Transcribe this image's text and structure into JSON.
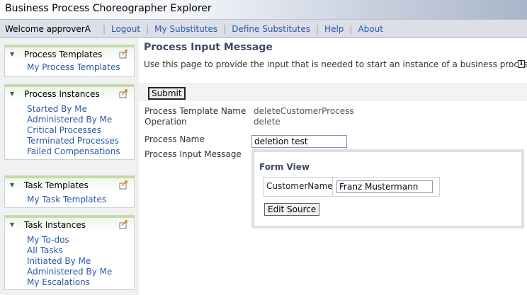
{
  "app": {
    "title": "Business Process Choreographer Explorer"
  },
  "nav": {
    "welcome": "Welcome approverA",
    "links": [
      "Logout",
      "My Substitutes",
      "Define Substitutes",
      "Help",
      "About"
    ],
    "separator": "|"
  },
  "sidebar": {
    "process_templates": {
      "title": "Process Templates",
      "items": [
        "My Process Templates"
      ]
    },
    "process_instances": {
      "title": "Process Instances",
      "items": [
        "Started By Me",
        "Administered By Me",
        "Critical Processes",
        "Terminated Processes",
        "Failed Compensations"
      ]
    },
    "task_templates": {
      "title": "Task Templates",
      "items": [
        "My Task Templates"
      ]
    },
    "task_instances": {
      "title": "Task Instances",
      "items": [
        "My To-dos",
        "All Tasks",
        "Initiated By Me",
        "Administered By Me",
        "My Escalations"
      ]
    }
  },
  "main": {
    "title": "Process Input Message",
    "description": "Use this page to provide the input that is needed to start an instance of a business process.",
    "info_icon": "i",
    "submit_label": "Submit",
    "template_name_label": "Process Template Name",
    "template_name_value": "deleteCustomerProcess",
    "operation_label": "Operation",
    "operation_value": "delete",
    "process_name_label": "Process Name",
    "process_name_value": "deletion test",
    "input_message_label": "Process Input Message",
    "form_view": {
      "title": "Form View",
      "field_label": "CustomerName",
      "field_value": "Franz Mustermann",
      "edit_source_label": "Edit Source"
    }
  },
  "colors": {
    "link": "#2b59a8",
    "heading": "#3d4a66",
    "panel_accent": "#c3dca2",
    "navbar": "#dcdee8"
  }
}
